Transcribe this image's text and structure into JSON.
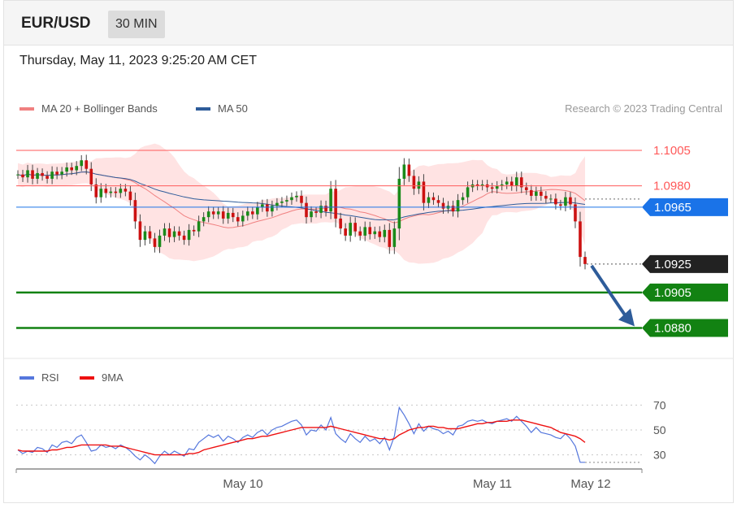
{
  "header": {
    "symbol": "EUR/USD",
    "timeframe": "30 MIN"
  },
  "timestamp": "Thursday, May 11, 2023 9:25:20 AM CET",
  "legend": {
    "main": [
      {
        "label": "MA 20 + Bollinger Bands",
        "color": "#f08080"
      },
      {
        "label": "MA 50",
        "color": "#2e5c9a"
      }
    ],
    "rsi": [
      {
        "label": "RSI",
        "color": "#5577dd"
      },
      {
        "label": "9MA",
        "color": "#ee1111"
      }
    ]
  },
  "credit": "Research © 2023 Trading Central",
  "chart_data": [
    {
      "type": "candlestick",
      "instrument": "EUR/USD",
      "interval": "30 MIN",
      "ylim": [
        1.0862,
        1.1025
      ],
      "x_ticks": [
        "May 10",
        "May 11",
        "May 12"
      ],
      "closes": [
        1.0988,
        1.0986,
        1.0991,
        1.0985,
        1.0989,
        1.0987,
        1.0985,
        1.099,
        1.0988,
        1.099,
        1.0993,
        1.0991,
        1.0994,
        1.0998,
        1.0992,
        1.0981,
        1.0972,
        1.0978,
        1.0975,
        1.0976,
        1.0975,
        1.0978,
        1.0976,
        1.097,
        1.0955,
        1.0942,
        1.0948,
        1.0943,
        1.0937,
        1.0945,
        1.095,
        1.0944,
        1.0948,
        1.0945,
        1.0942,
        1.0949,
        1.0948,
        1.0955,
        1.0958,
        1.0962,
        1.096,
        1.0962,
        1.0957,
        1.0961,
        1.0958,
        1.0955,
        1.0959,
        1.0962,
        1.096,
        1.0965,
        1.0967,
        1.0962,
        1.0966,
        1.0968,
        1.0969,
        1.097,
        1.0972,
        1.0973,
        1.0968,
        1.0958,
        1.0962,
        1.0961,
        1.0966,
        1.0962,
        1.0978,
        1.0957,
        1.095,
        1.0945,
        1.0954,
        1.0948,
        1.0945,
        1.0951,
        1.0946,
        1.0948,
        1.0944,
        1.0949,
        1.0937,
        1.095,
        1.0985,
        1.0995,
        1.0987,
        1.0978,
        1.0983,
        1.0968,
        1.0972,
        1.097,
        1.0968,
        1.0964,
        1.0966,
        1.0962,
        1.097,
        1.0972,
        1.0979,
        1.0981,
        1.098,
        1.0981,
        1.0979,
        1.0978,
        1.098,
        1.0981,
        1.0983,
        1.098,
        1.0986,
        1.0979,
        1.0977,
        1.0973,
        1.0976,
        1.0973,
        1.0971,
        1.0971,
        1.0967,
        1.0966,
        1.0972,
        1.0967,
        1.0955,
        1.093,
        1.0925
      ],
      "levels": [
        {
          "value": 1.1005,
          "label": "1.1005",
          "style": "red-line",
          "color": "#ff5a5a"
        },
        {
          "value": 1.098,
          "label": "1.0980",
          "style": "red-line",
          "color": "#ff5a5a"
        },
        {
          "value": 1.0965,
          "label": "1.0965",
          "style": "blue-line",
          "color": "#1a73e8"
        },
        {
          "value": 1.0925,
          "label": "1.0925",
          "style": "current-price",
          "color": "#222222"
        },
        {
          "value": 1.0905,
          "label": "1.0905",
          "style": "green-target",
          "color": "#128212"
        },
        {
          "value": 1.088,
          "label": "1.0880",
          "style": "green-target",
          "color": "#128212"
        }
      ],
      "colors": {
        "up": "#1a8a1a",
        "down": "#cc1111",
        "band": "#ffd9d9",
        "ma20": "#f08080",
        "ma50": "#2e5c9a",
        "arrow": "#2e5c9a"
      }
    },
    {
      "type": "line",
      "indicator": "RSI",
      "y_ticks": [
        70,
        50,
        30
      ],
      "ylim": [
        18,
        82
      ],
      "series": [
        {
          "name": "RSI",
          "values": [
            34,
            31,
            33,
            32,
            36,
            35,
            32,
            38,
            36,
            40,
            41,
            39,
            44,
            46,
            40,
            33,
            34,
            38,
            36,
            37,
            35,
            38,
            36,
            33,
            29,
            26,
            30,
            27,
            23,
            29,
            33,
            30,
            33,
            31,
            29,
            35,
            34,
            40,
            43,
            46,
            44,
            46,
            41,
            45,
            43,
            40,
            44,
            46,
            44,
            48,
            50,
            46,
            50,
            52,
            53,
            55,
            57,
            58,
            54,
            46,
            50,
            49,
            54,
            50,
            60,
            47,
            43,
            40,
            47,
            43,
            40,
            45,
            41,
            43,
            39,
            44,
            34,
            45,
            68,
            62,
            55,
            47,
            55,
            49,
            53,
            51,
            50,
            47,
            49,
            46,
            53,
            54,
            57,
            58,
            57,
            58,
            56,
            55,
            57,
            58,
            59,
            57,
            61,
            57,
            53,
            48,
            52,
            48,
            47,
            46,
            44,
            43,
            47,
            43,
            37,
            24,
            24
          ]
        },
        {
          "name": "9MA",
          "values": [
            34,
            33,
            33,
            33,
            33,
            33,
            33,
            34,
            34,
            35,
            36,
            36,
            37,
            38,
            38,
            38,
            38,
            38,
            38,
            37,
            37,
            37,
            36,
            35,
            34,
            33,
            32,
            31,
            30,
            30,
            30,
            30,
            30,
            30,
            30,
            31,
            31,
            32,
            34,
            35,
            36,
            37,
            38,
            39,
            40,
            41,
            42,
            43,
            43,
            44,
            45,
            45,
            46,
            47,
            48,
            49,
            50,
            51,
            52,
            52,
            52,
            52,
            52,
            52,
            53,
            52,
            51,
            50,
            49,
            48,
            47,
            46,
            45,
            44,
            43,
            43,
            42,
            43,
            46,
            48,
            50,
            51,
            52,
            52,
            53,
            53,
            52,
            52,
            51,
            51,
            51,
            52,
            53,
            54,
            55,
            55,
            56,
            56,
            57,
            57,
            57,
            58,
            58,
            58,
            57,
            56,
            55,
            54,
            53,
            52,
            50,
            48,
            47,
            46,
            45,
            43,
            40
          ]
        }
      ]
    }
  ]
}
